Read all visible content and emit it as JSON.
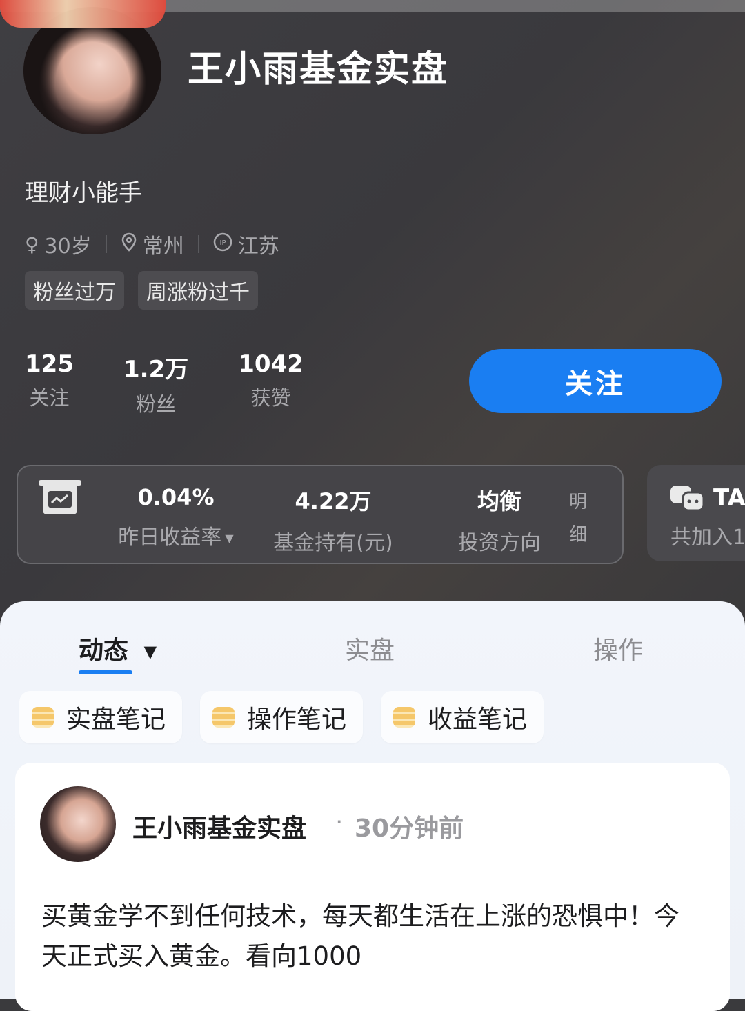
{
  "profile": {
    "name": "王小雨基金实盘",
    "bio": "理财小能手",
    "age": "30岁",
    "city": "常州",
    "ip_location": "江苏",
    "badges": [
      "粉丝过万",
      "周涨粉过千"
    ]
  },
  "stats": [
    {
      "value": "125",
      "label": "关注"
    },
    {
      "value": "1.2万",
      "label": "粉丝"
    },
    {
      "value": "1042",
      "label": "获赞"
    }
  ],
  "follow_button": "关注",
  "fund_card": {
    "yield_value": "0.04%",
    "yield_label": "昨日收益率",
    "holding_value": "4.22万",
    "holding_label": "基金持有(元)",
    "direction_value": "均衡",
    "direction_label": "投资方向",
    "detail_top": "明",
    "detail_bottom": "细"
  },
  "ta_card": {
    "title": "TA",
    "subtitle": "共加入1"
  },
  "tabs": [
    {
      "label": "动态"
    },
    {
      "label": "实盘"
    },
    {
      "label": "操作"
    }
  ],
  "chips": [
    {
      "label": "实盘笔记"
    },
    {
      "label": "操作笔记"
    },
    {
      "label": "收益笔记"
    }
  ],
  "post": {
    "author": "王小雨基金实盘",
    "separator": "·",
    "time": "30分钟前",
    "text": "买黄金学不到任何技术，每天都生活在上涨的恐惧中！今天正式买入黄金。看向1000"
  },
  "colors": {
    "accent": "#1a7ef2",
    "hero_bg": "#3a3a3d",
    "panel_bg": "#f2f5fb"
  }
}
